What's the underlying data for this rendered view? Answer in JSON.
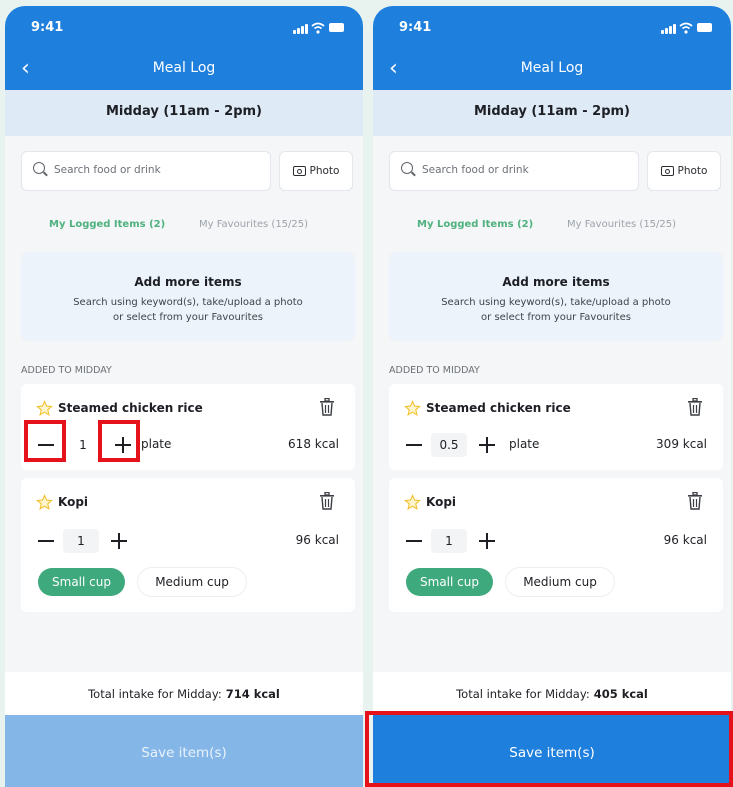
{
  "screens": [
    {
      "status_time": "9:41",
      "title": "Meal Log",
      "meal_time": "Midday (11am - 2pm)",
      "search_placeholder": "Search food or drink",
      "photo_label": "Photo",
      "tabs": {
        "logged": "My Logged Items (2)",
        "favourites": "My Favourites (15/25)"
      },
      "add_card": {
        "title": "Add more items",
        "line1": "Search using keyword(s), take/upload a photo",
        "line2": "or select from your Favourites"
      },
      "section_label": "ADDED TO MIDDAY",
      "items": [
        {
          "name": "Steamed chicken rice",
          "qty": "1",
          "unit": "plate",
          "kcal": "618 kcal"
        },
        {
          "name": "Kopi",
          "qty": "1",
          "kcal": "96 kcal",
          "sizes": [
            "Small cup",
            "Medium cup"
          ],
          "selected_size": "Small cup"
        }
      ],
      "total_label": "Total intake for Midday:",
      "total_value": "714 kcal",
      "save_label": "Save item(s)",
      "save_enabled": false
    },
    {
      "status_time": "9:41",
      "title": "Meal Log",
      "meal_time": "Midday (11am - 2pm)",
      "search_placeholder": "Search food or drink",
      "photo_label": "Photo",
      "tabs": {
        "logged": "My Logged Items (2)",
        "favourites": "My Favourites (15/25)"
      },
      "add_card": {
        "title": "Add more items",
        "line1": "Search using keyword(s), take/upload a photo",
        "line2": "or select from your Favourites"
      },
      "section_label": "ADDED TO MIDDAY",
      "items": [
        {
          "name": "Steamed chicken rice",
          "qty": "0.5",
          "unit": "plate",
          "kcal": "309 kcal"
        },
        {
          "name": "Kopi",
          "qty": "1",
          "kcal": "96 kcal",
          "sizes": [
            "Small cup",
            "Medium cup"
          ],
          "selected_size": "Small cup"
        }
      ],
      "total_label": "Total intake for Midday:",
      "total_value": "405 kcal",
      "save_label": "Save item(s)",
      "save_enabled": true
    }
  ],
  "colors": {
    "brand_blue": "#1f7fdc",
    "accent_green": "#3ea97c",
    "highlight_red": "#e5121b"
  },
  "icons": [
    "back-icon",
    "search-icon",
    "camera-icon",
    "star-icon",
    "trash-icon",
    "minus-icon",
    "plus-icon"
  ]
}
